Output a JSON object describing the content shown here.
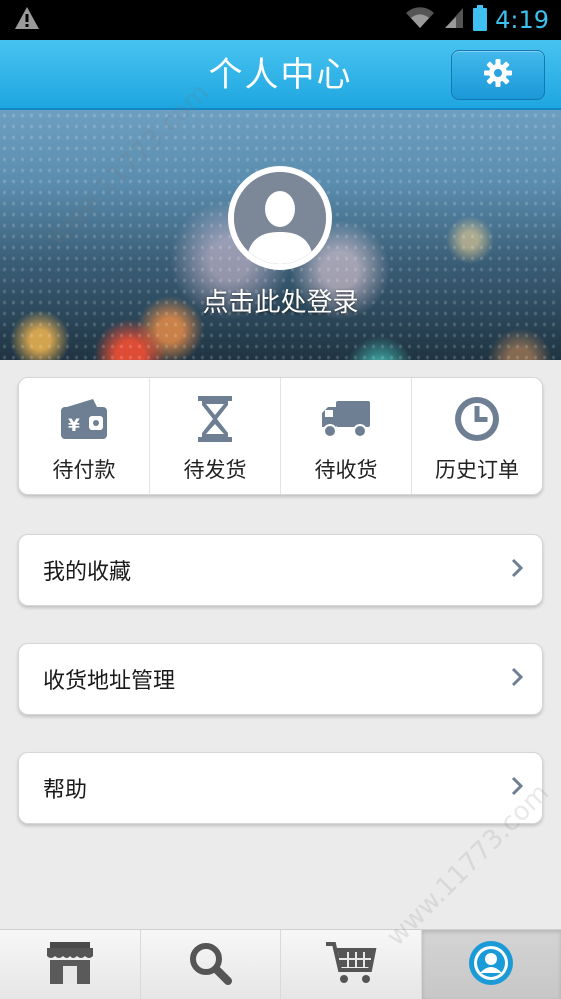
{
  "status_bar": {
    "time": "4:19",
    "warning_icon": "warning-icon",
    "wifi_icon": "wifi-icon",
    "signal_icon": "signal-icon",
    "battery_icon": "battery-icon"
  },
  "header": {
    "title": "个人中心",
    "settings_icon": "gear-icon",
    "accent_color": "#2ab0e6"
  },
  "profile": {
    "login_prompt": "点击此处登录",
    "avatar_icon": "user-avatar-icon"
  },
  "orders": [
    {
      "label": "待付款",
      "icon": "wallet-icon"
    },
    {
      "label": "待发货",
      "icon": "hourglass-icon"
    },
    {
      "label": "待收货",
      "icon": "truck-icon"
    },
    {
      "label": "历史订单",
      "icon": "clock-icon"
    }
  ],
  "menu": [
    {
      "label": "我的收藏"
    },
    {
      "label": "收货地址管理"
    },
    {
      "label": "帮助"
    }
  ],
  "bottom_nav": [
    {
      "icon": "store-icon"
    },
    {
      "icon": "search-icon"
    },
    {
      "icon": "cart-icon"
    },
    {
      "icon": "profile-icon",
      "active": true
    }
  ],
  "watermark": "www.11773.com"
}
